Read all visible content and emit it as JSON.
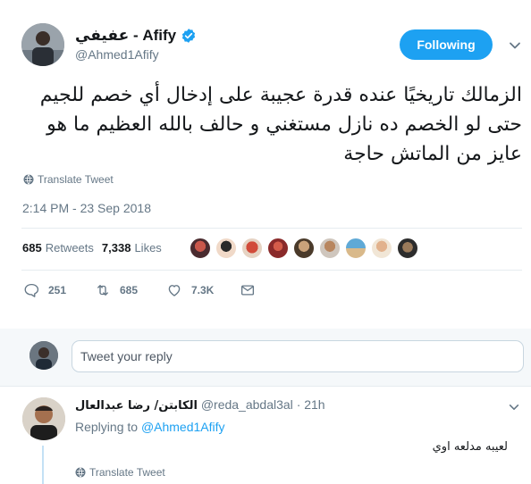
{
  "tweet": {
    "author": {
      "display_name": "عفيفي - Afify",
      "handle": "@Ahmed1Afify",
      "verified": true
    },
    "follow_button": "Following",
    "text": "الزمالك تاريخيًا عنده قدرة عجيبة على إدخال أي خصم للجيم حتى لو الخصم ده نازل مستغني و حالف بالله العظيم ما هو عايز من الماتش حاجة",
    "translate_label": "Translate Tweet",
    "timestamp": "2:14 PM - 23 Sep 2018",
    "stats": {
      "retweets_count": "685",
      "retweets_label": "Retweets",
      "likes_count": "7,338",
      "likes_label": "Likes"
    },
    "actions": {
      "replies": "251",
      "retweets": "685",
      "likes": "7.3K"
    }
  },
  "reply_box": {
    "placeholder": "Tweet your reply"
  },
  "reply": {
    "display_name": "الكابتن/ رضا عبدالعال",
    "handle": "@reda_abdal3al",
    "time": "· 21h",
    "replying_prefix": "Replying to",
    "replying_to": "@Ahmed1Afify",
    "text": "لعيبه مدلعه اوي",
    "translate_label": "Translate Tweet"
  },
  "colors": {
    "accent": "#1da1f2",
    "muted": "#657786",
    "text": "#14171a",
    "divider": "#e6ecf0"
  }
}
